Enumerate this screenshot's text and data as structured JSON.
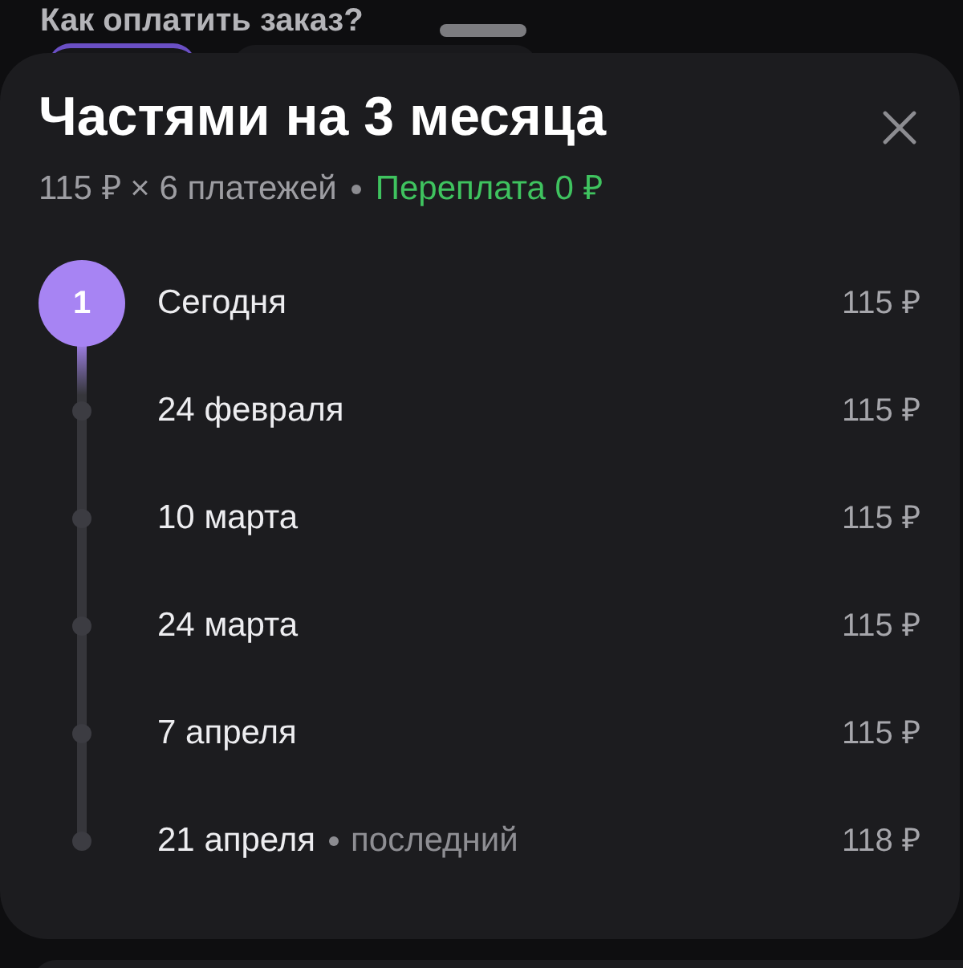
{
  "page": {
    "heading": "Как оплатить заказ?"
  },
  "sheet": {
    "title": "Частями на 3 месяца",
    "summary": {
      "payments": "115 ₽ × 6 платежей",
      "overpayment": "Переплата 0 ₽"
    },
    "schedule": [
      {
        "date": "Сегодня",
        "amount": "115 ₽",
        "current": true,
        "step": "1"
      },
      {
        "date": "24 февраля",
        "amount": "115 ₽",
        "current": false
      },
      {
        "date": "10 марта",
        "amount": "115 ₽",
        "current": false
      },
      {
        "date": "24 марта",
        "amount": "115 ₽",
        "current": false
      },
      {
        "date": "7 апреля",
        "amount": "115 ₽",
        "current": false
      },
      {
        "date": "21 апреля",
        "note": "последний",
        "amount": "118 ₽",
        "current": false
      }
    ]
  }
}
